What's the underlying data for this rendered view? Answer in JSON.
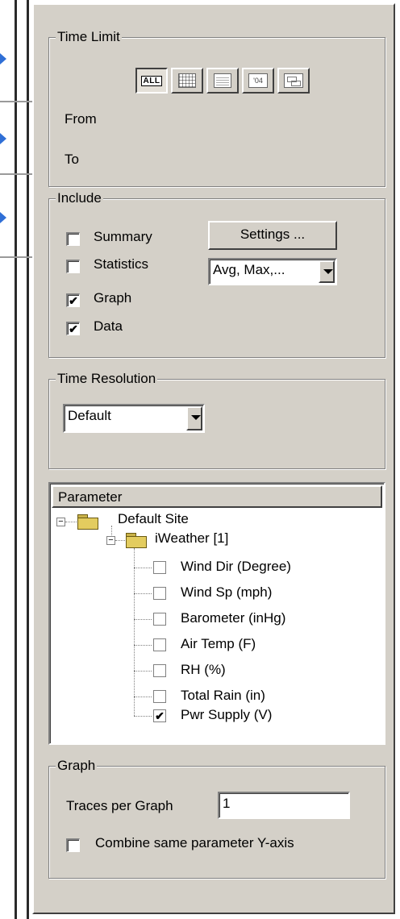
{
  "time_limit": {
    "legend": "Time Limit",
    "buttons": [
      {
        "icon": "all-icon",
        "text": "ALL"
      },
      {
        "icon": "week-calendar-icon"
      },
      {
        "icon": "month-calendar-icon"
      },
      {
        "icon": "year-icon",
        "text": "'04"
      },
      {
        "icon": "date-range-icon"
      }
    ],
    "from_label": "From",
    "to_label": "To"
  },
  "include": {
    "legend": "Include",
    "options": [
      {
        "label": "Summary",
        "checked": false
      },
      {
        "label": "Statistics",
        "checked": false
      },
      {
        "label": "Graph",
        "checked": true
      },
      {
        "label": "Data",
        "checked": true
      }
    ],
    "settings_button": "Settings ...",
    "stats_select_value": "Avg, Max,..."
  },
  "time_resolution": {
    "legend": "Time Resolution",
    "select_value": "Default"
  },
  "parameter": {
    "header": "Parameter",
    "site": "Default Site",
    "station": "iWeather [1]",
    "items": [
      {
        "label": "Wind Dir (Degree)",
        "checked": false
      },
      {
        "label": "Wind Sp (mph)",
        "checked": false
      },
      {
        "label": "Barometer (inHg)",
        "checked": false
      },
      {
        "label": "Air Temp (F)",
        "checked": false
      },
      {
        "label": "RH (%)",
        "checked": false
      },
      {
        "label": "Total Rain (in)",
        "checked": false
      },
      {
        "label": "Pwr Supply (V)",
        "checked": true
      }
    ]
  },
  "graph": {
    "legend": "Graph",
    "traces_label": "Traces per Graph",
    "traces_value": "1",
    "combine_label": "Combine same parameter Y-axis",
    "combine_checked": false
  },
  "colors": {
    "panel": "#d4d0c8",
    "marker": "#2f6fd6"
  }
}
